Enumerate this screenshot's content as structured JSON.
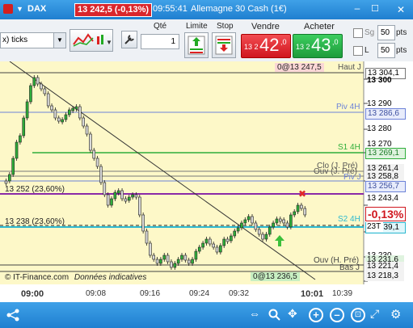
{
  "window": {
    "symbol": "DAX",
    "price_change": "13 242,5 (-0,13%)",
    "time": "09:55:41",
    "instrument": "Allemagne 30 Cash (1€)"
  },
  "toolbar": {
    "timeframe": "x) ticks",
    "qty_label": "Qté",
    "qty_value": "1",
    "limit_label": "Limite",
    "stop_label": "Stop",
    "sell_label": "Vendre",
    "sell_price_small": "13 2",
    "sell_price_big": "42",
    "sell_price_dec": ",0",
    "buy_label": "Acheter",
    "buy_price_small": "13 2",
    "buy_price_big": "43",
    "buy_price_dec": ",0",
    "sg_label": "Sg",
    "sg_value": "50",
    "sg_unit": "pts",
    "l_label": "L",
    "l_value": "50",
    "l_unit": "pts"
  },
  "chart": {
    "top_marker": "0@13 247,5",
    "bottom_marker": "0@13 236,5",
    "current_change": "-0,13%",
    "copyright": "© IT-Finance.com",
    "data_note": "Données indicatives",
    "line_labels": {
      "haut": "Haut J",
      "piv4h": "Piv 4H",
      "s14h": "S1 4H",
      "clo": "Clo (J. Pré)",
      "ouv": "Ouv (J. Pré)",
      "pivj": "Piv J",
      "fib1": "13 252 (23,60%)",
      "fib2": "13 238 (23,60%)",
      "s24h": "S2 4H",
      "ouvh": "Ouv (H. Pré)",
      "bas": "Bas J"
    },
    "price_labels": {
      "p13304": "13 304,1",
      "p13300": "13 300",
      "p13290": "13 290",
      "p13286": "13 286,6",
      "p13280": "13 280",
      "p13270": "13 270",
      "p13269": "13 269,1",
      "p13261": "13 261,4",
      "p13258": "13 258,8",
      "p13256": "13 256,7",
      "p13243": "13 243,4",
      "p13239": "13 239,1",
      "p23t": "23T",
      "p13230": "13 230",
      "p13231": "13 231,6",
      "p13221": "13 221,4",
      "p13218": "13 218,3"
    },
    "x_labels": [
      "09:00",
      "09:08",
      "09:16",
      "09:24",
      "09:32",
      "10:01",
      "10:39"
    ]
  },
  "colors": {
    "title_bg": "#2a8ee0",
    "chart_bg": "#fdf8c8",
    "sell": "#e0262e",
    "buy": "#27b14a",
    "green_line": "#2eae3a",
    "blue_line": "#6c82d8",
    "purple_line": "#8a2aa8",
    "cyan_line": "#2bb8d0"
  },
  "icons": [
    "logo-icon",
    "dropdown-icon",
    "chart-tools-icon",
    "wrench-icon",
    "minimize-icon",
    "maximize-icon",
    "close-icon",
    "share-icon",
    "arrows-icon",
    "search-icon",
    "pan-icon",
    "zoom-in-icon",
    "zoom-out-icon",
    "zoom-fit-icon",
    "settings-icon"
  ]
}
